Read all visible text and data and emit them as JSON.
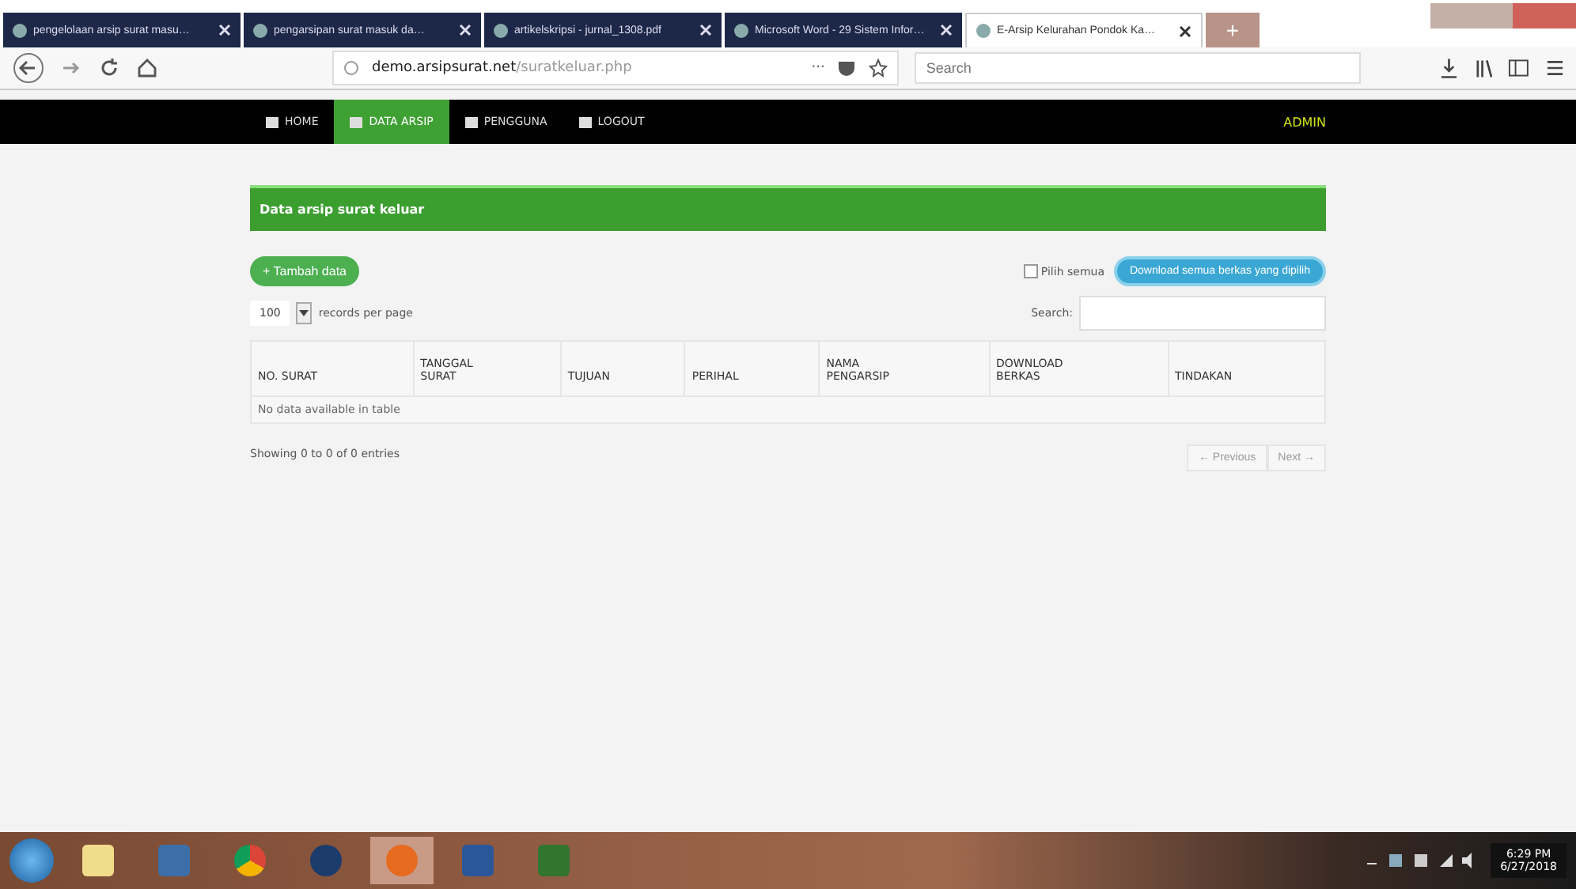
{
  "browser": {
    "tabs": [
      {
        "title": "pengelolaan arsip surat masu…",
        "selected": false
      },
      {
        "title": "pengarsipan surat masuk da…",
        "selected": false
      },
      {
        "title": "artikelskripsi - jurnal_1308.pdf",
        "selected": false
      },
      {
        "title": "Microsoft Word - 29 Sistem Infor…",
        "selected": false
      },
      {
        "title": "E-Arsip Kelurahan Pondok Ka…",
        "selected": true
      }
    ],
    "new_tab": "+",
    "url_host": "demo.arsipsurat.net",
    "url_path": "/suratkeluar.php",
    "menu_dots": "···",
    "search": {
      "placeholder": "Search"
    }
  },
  "navbar": {
    "items": [
      {
        "label": "HOME",
        "selected": false
      },
      {
        "label": "DATA ARSIP",
        "selected": true
      },
      {
        "label": "PENGGUNA",
        "selected": false
      },
      {
        "label": "LOGOUT",
        "selected": false
      }
    ],
    "user": "ADMIN"
  },
  "panel": {
    "title": "Data arsip surat keluar",
    "add_button": "+ Tambah data",
    "select_all": {
      "label": "Pilih semua",
      "checked": false
    },
    "download_button": "Download semua berkas yang dipilih",
    "page_size": "100",
    "page_size_label": "records per page",
    "search_label": "Search:",
    "table": {
      "columns": [
        [
          "NO. SURAT"
        ],
        [
          "TANGGAL",
          "SURAT"
        ],
        [
          "TUJUAN"
        ],
        [
          "PERIHAL"
        ],
        [
          "NAMA",
          "PENGARSIP"
        ],
        [
          "DOWNLOAD",
          "BERKAS"
        ],
        [
          "TINDAKAN"
        ]
      ],
      "empty": "No data available in table"
    },
    "info": "Showing 0 to 0 of 0 entries",
    "prev": "← Previous",
    "next": "Next →"
  },
  "taskbar": {
    "time": "6:29 PM",
    "date": "6/27/2018"
  }
}
